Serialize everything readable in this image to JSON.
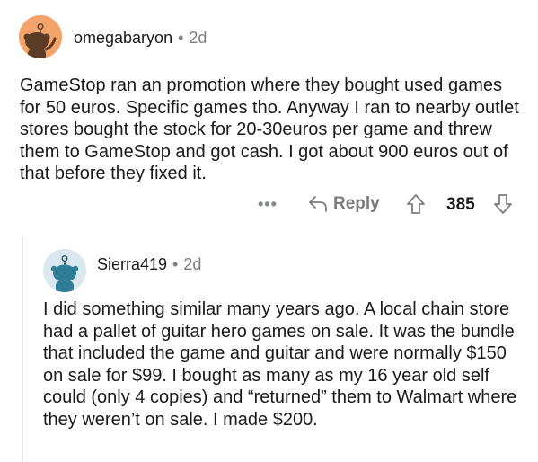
{
  "comments": [
    {
      "username": "omegabaryon",
      "separator": "•",
      "age": "2d",
      "avatar_icon": "snoo-avatar-icon",
      "avatar_color": "#f4a46a",
      "body": "GameStop ran an promotion where they bought used games for 50 euros. Specific games tho. Anyway I ran to nearby outlet stores bought the stock for 20-30euros per game and threw them to GameStop and got cash. I got about 900 euros out of that before they fixed it.",
      "actions": {
        "more_label": "•••",
        "reply_label": "Reply",
        "score": "385"
      }
    },
    {
      "username": "Sierra419",
      "separator": "•",
      "age": "2d",
      "avatar_icon": "snoo-avatar-icon",
      "avatar_color": "#dbe7ef",
      "body": "I did something similar many years ago. A local chain store had a pallet of guitar hero games on sale. It was the bundle that included the game and guitar and were normally $150 on sale for $99. I bought as many as my 16 year old self could (only 4 copies) and “returned” them to Walmart where they weren’t on sale. I made $200."
    }
  ],
  "colors": {
    "text": "#1a1a1b",
    "meta": "#7c7c7c"
  }
}
